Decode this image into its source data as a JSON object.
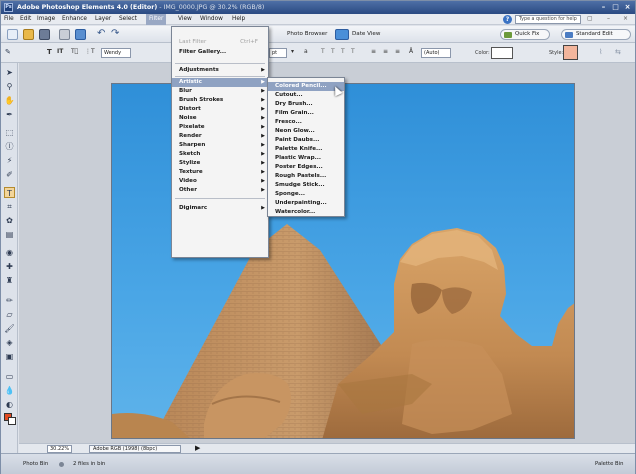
{
  "titlebar": {
    "title": "Adobe Photoshop Elements 4.0 (Editor)",
    "file": " - IMG_0000.JPG @ 30.2% (RGB/8)",
    "minimize": "–",
    "maximize": "□",
    "close": "×"
  },
  "menubar": {
    "items": [
      "File",
      "Edit",
      "Image",
      "Enhance",
      "Layer",
      "Select",
      "Filter",
      "View",
      "Window",
      "Help"
    ],
    "active": "Filter",
    "help_placeholder": "Type a question for help",
    "help_icon": "?",
    "right_buttons": [
      "▢",
      "–",
      "×"
    ]
  },
  "shortcuts": {
    "photo_browser": "Photo Browser",
    "date_view": "Date View",
    "quick_fix": "Quick Fix",
    "standard_edit": "Standard Edit"
  },
  "options": {
    "font": "Wendy",
    "size": "pt",
    "aa_label": "a",
    "leading": "(Auto)",
    "color_label": "Color:",
    "style_label": "Style:"
  },
  "filter_menu": {
    "items": [
      {
        "label": "Last Filter",
        "shortcut": "Ctrl+F",
        "disabled": true
      },
      {
        "label": "Filter Gallery...",
        "disabled": false
      },
      {
        "label": "Adjustments",
        "submenu": true
      },
      {
        "label": "Artistic",
        "submenu": true,
        "highlighted": true
      },
      {
        "label": "Blur",
        "submenu": true
      },
      {
        "label": "Brush Strokes",
        "submenu": true
      },
      {
        "label": "Distort",
        "submenu": true
      },
      {
        "label": "Noise",
        "submenu": true
      },
      {
        "label": "Pixelate",
        "submenu": true
      },
      {
        "label": "Render",
        "submenu": true
      },
      {
        "label": "Sharpen",
        "submenu": true
      },
      {
        "label": "Sketch",
        "submenu": true
      },
      {
        "label": "Stylize",
        "submenu": true
      },
      {
        "label": "Texture",
        "submenu": true
      },
      {
        "label": "Video",
        "submenu": true
      },
      {
        "label": "Other",
        "submenu": true
      },
      {
        "label": "Digimarc",
        "submenu": true
      }
    ],
    "arrow": "▶"
  },
  "artistic_menu": {
    "items": [
      "Colored Pencil...",
      "Cutout...",
      "Dry Brush...",
      "Film Grain...",
      "Fresco...",
      "Neon Glow...",
      "Paint Daubs...",
      "Palette Knife...",
      "Plastic Wrap...",
      "Poster Edges...",
      "Rough Pastels...",
      "Smudge Stick...",
      "Sponge...",
      "Underpainting...",
      "Watercolor..."
    ],
    "highlighted_index": 0
  },
  "docstatus": {
    "zoom": "30.22%",
    "profile": "Adobe RGB (1998) (8bpc)",
    "arrow": "▶"
  },
  "photobin": {
    "label": "Photo Bin",
    "count": "2 files in bin",
    "palette_bin": "Palette Bin"
  },
  "colors": {
    "menu_highlight": "#8fa2c2",
    "sky": "#3a98dc",
    "sand": "#c8935a"
  }
}
